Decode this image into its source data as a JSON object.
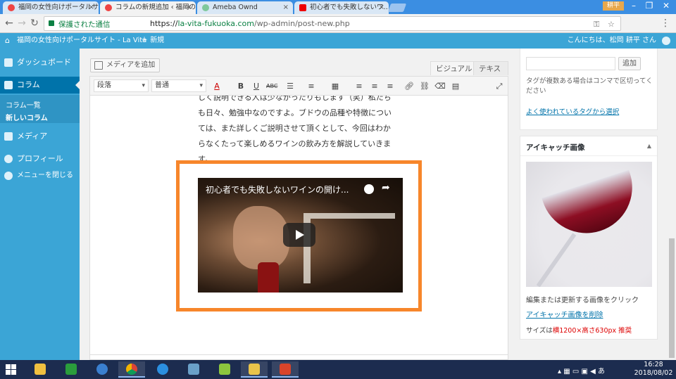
{
  "browser": {
    "tabs": [
      {
        "label": "福岡の女性向けポータルサ…"
      },
      {
        "label": "コラムの新規追加 ‹ 福岡の…"
      },
      {
        "label": "Ameba Ownd"
      },
      {
        "label": "初心者でも失敗しないワ…"
      }
    ],
    "user_badge": "耕平",
    "secure_label": "保護された通信",
    "url_scheme": "https://",
    "url_host": "la-vita-fukuoka.com",
    "url_path": "/wp-admin/post-new.php"
  },
  "adminbar": {
    "site_name": "福岡の女性向けポータルサイト - La Vita",
    "new_label": "新規",
    "howdy": "こんにちは、松岡 耕平 さん"
  },
  "sidebar": {
    "items": [
      {
        "label": "ダッシュボード"
      },
      {
        "label": "コラム"
      },
      {
        "label": "メディア"
      },
      {
        "label": "プロフィール"
      },
      {
        "label": "メニューを閉じる"
      }
    ],
    "submenu": [
      {
        "label": "コラム一覧"
      },
      {
        "label": "新しいコラム"
      }
    ]
  },
  "editor": {
    "add_media": "メディアを追加",
    "visual_tab": "ビジュアル",
    "text_tab": "テキスト",
    "format_select": "段落",
    "font_select": "普通",
    "paragraph_lines": [
      "しく説明できる人は少なかったりもします（笑）私たち",
      "も日々、勉強中なのですよ。ブドウの品種や特徴につい",
      "ては、また詳しくご説明させて頂くとして、今回はわか",
      "らなくたって楽しめるワインの飲み方を解説していきま",
      "す。"
    ],
    "video_title": "初心者でも失敗しないワインの開け..."
  },
  "tags_box": {
    "add_button": "追加",
    "hint": "タグが複数ある場合はコンマで区切ってください",
    "popular_link": "よく使われているタグから選択"
  },
  "featured_box": {
    "title": "アイキャッチ画像",
    "caption": "編集または更新する画像をクリック",
    "remove_link": "アイキャッチ画像を削除",
    "size_prefix": "サイズは",
    "size_value": "横1200×高さ630px 推奨"
  },
  "taskbar": {
    "time": "16:28",
    "date": "2018/08/02",
    "ime": "あ"
  },
  "colors": {
    "admin_blue": "#3ba5d6",
    "highlight_orange": "#f7862b",
    "link": "#0073aa"
  }
}
